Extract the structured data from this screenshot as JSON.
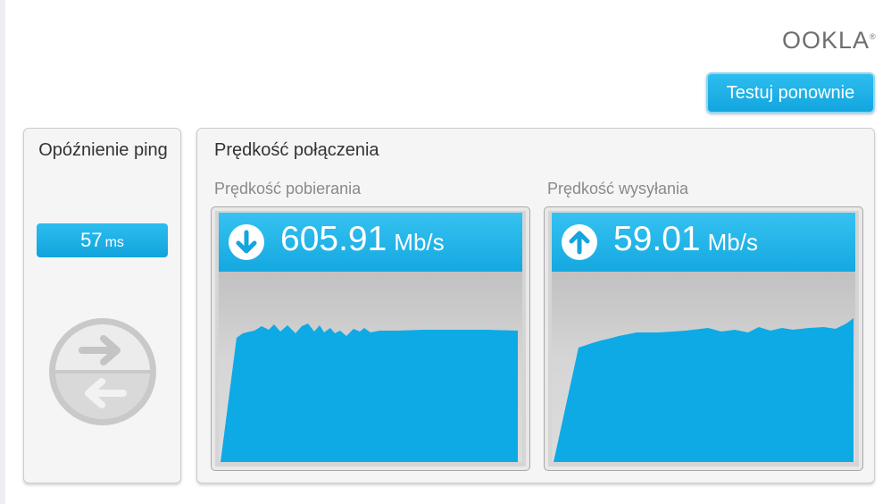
{
  "brand": {
    "logo_text": "OOKLA",
    "logo_mark": "®"
  },
  "toolbar": {
    "retest_label": "Testuj ponownie"
  },
  "ping": {
    "title": "Opóźnienie ping",
    "value": "57",
    "unit": "ms"
  },
  "speed": {
    "title": "Prędkość połączenia",
    "download": {
      "label": "Prędkość pobierania",
      "value": "605.91",
      "unit": "Mb/s",
      "icon": "arrow-down-icon"
    },
    "upload": {
      "label": "Prędkość wysyłania",
      "value": "59.01",
      "unit": "Mb/s",
      "icon": "arrow-up-icon"
    }
  },
  "colors": {
    "accent": "#13a5de",
    "graph_fill": "#0daae6",
    "panel_bg": "#f5f5f5"
  }
}
